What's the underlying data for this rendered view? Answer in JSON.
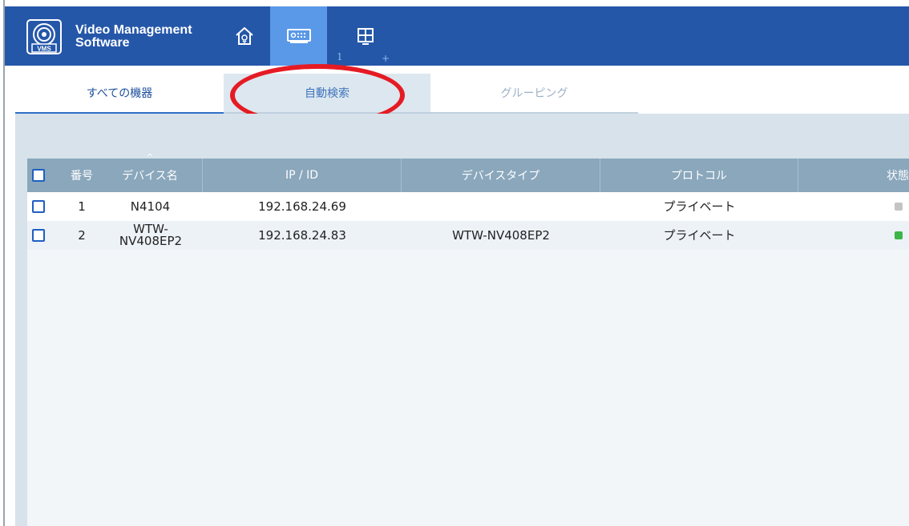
{
  "app": {
    "title_line1": "Video Management",
    "title_line2": "Software",
    "logo_text": "VMS"
  },
  "nav": {
    "view_badge": "1",
    "view_add": "+"
  },
  "tabs": [
    {
      "label": "すべての機器"
    },
    {
      "label": "自動検索"
    },
    {
      "label": "グルーピング"
    }
  ],
  "table": {
    "columns": [
      "番号",
      "デバイス名",
      "IP / ID",
      "デバイスタイプ",
      "プロトコル",
      "状態"
    ],
    "sort_indicator": "^",
    "rows": [
      {
        "num": "1",
        "name": "N4104",
        "ip": "192.168.24.69",
        "type": "",
        "protocol": "プライベート",
        "status_color": "#c4c4c4"
      },
      {
        "num": "2",
        "name": "WTW-NV408EP2",
        "ip": "192.168.24.83",
        "type": "WTW-NV408EP2",
        "protocol": "プライベート",
        "status_color": "#3cb54a"
      }
    ]
  },
  "colors": {
    "header_bg": "#2557a9",
    "active_nav": "#5a98e8",
    "annotation": "#e51b24"
  }
}
